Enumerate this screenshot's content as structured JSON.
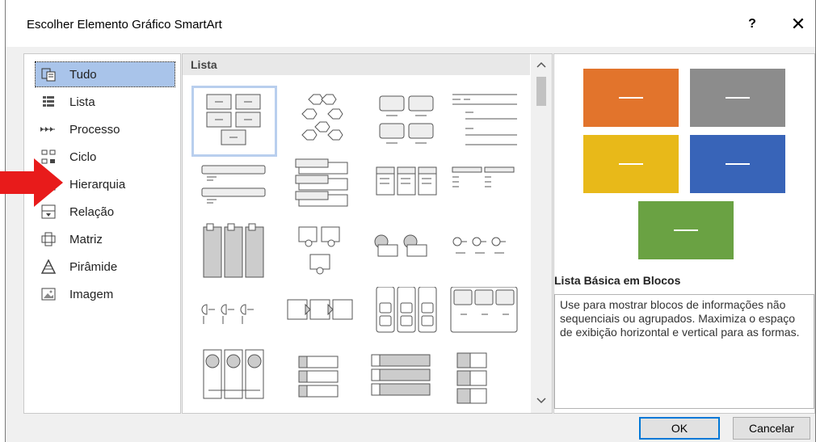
{
  "window": {
    "title": "Escolher Elemento Gráfico SmartArt",
    "help_label": "?",
    "close_label": "✕"
  },
  "categories": [
    {
      "label": "Tudo",
      "icon": "all-icon",
      "selected": true
    },
    {
      "label": "Lista",
      "icon": "list-icon"
    },
    {
      "label": "Processo",
      "icon": "process-icon"
    },
    {
      "label": "Ciclo",
      "icon": "cycle-icon"
    },
    {
      "label": "Hierarquia",
      "icon": "hierarchy-icon"
    },
    {
      "label": "Relação",
      "icon": "relationship-icon"
    },
    {
      "label": "Matriz",
      "icon": "matrix-icon"
    },
    {
      "label": "Pirâmide",
      "icon": "pyramid-icon"
    },
    {
      "label": "Imagem",
      "icon": "picture-icon"
    }
  ],
  "gallery": {
    "section_title": "Lista",
    "scroll_up": "^",
    "scroll_down": "v"
  },
  "preview": {
    "title": "Lista Básica em Blocos",
    "description": "Use para mostrar blocos de informações não sequenciais ou agrupados. Maximiza o espaço de exibição horizontal e vertical para as formas.",
    "colors": [
      "#e2742c",
      "#8c8c8c",
      "#e8b919",
      "#3864b8",
      "#6aa243"
    ]
  },
  "buttons": {
    "ok": "OK",
    "cancel": "Cancelar"
  },
  "annotation": {
    "color": "#e81b1b"
  }
}
